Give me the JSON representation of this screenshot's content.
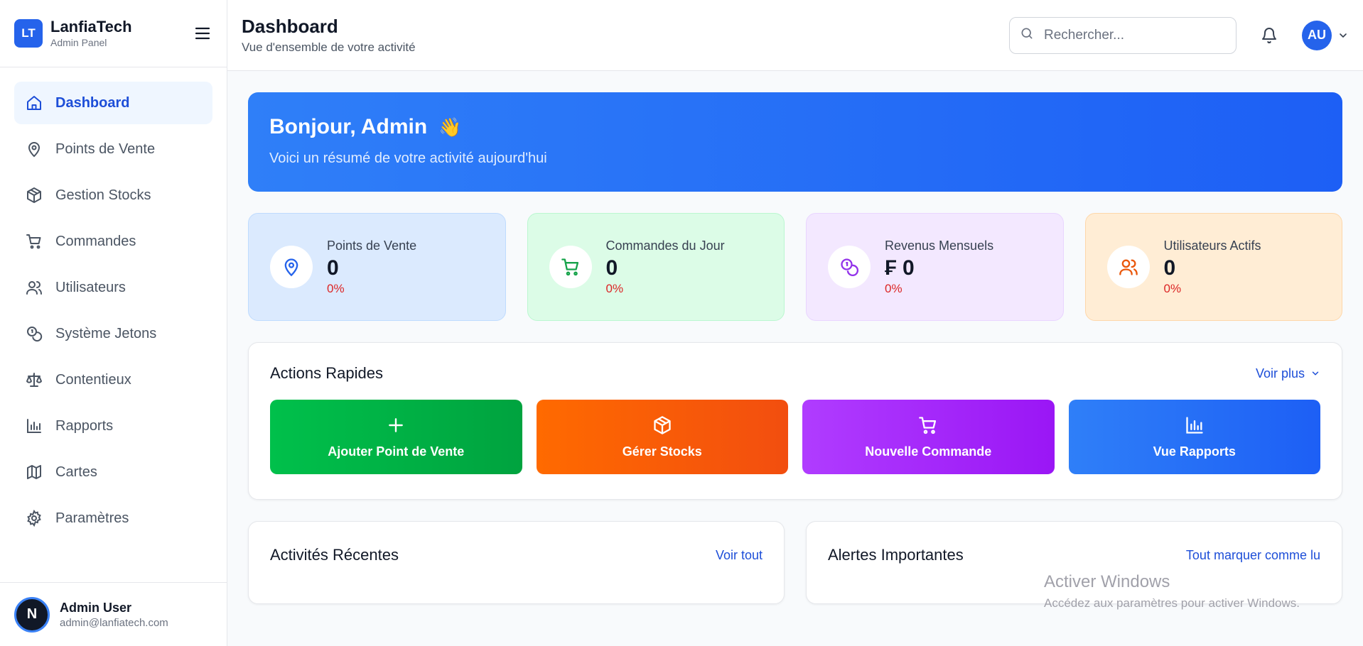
{
  "brand": {
    "logo": "LT",
    "name": "LanfiaTech",
    "subtitle": "Admin Panel"
  },
  "sidebar": {
    "items": [
      {
        "label": "Dashboard",
        "icon": "home-icon",
        "active": true
      },
      {
        "label": "Points de Vente",
        "icon": "map-pin-icon"
      },
      {
        "label": "Gestion Stocks",
        "icon": "package-icon"
      },
      {
        "label": "Commandes",
        "icon": "cart-icon"
      },
      {
        "label": "Utilisateurs",
        "icon": "users-icon"
      },
      {
        "label": "Système Jetons",
        "icon": "coins-icon"
      },
      {
        "label": "Contentieux",
        "icon": "scale-icon"
      },
      {
        "label": "Rapports",
        "icon": "bar-chart-icon"
      },
      {
        "label": "Cartes",
        "icon": "map-icon"
      },
      {
        "label": "Paramètres",
        "icon": "gear-icon"
      }
    ]
  },
  "user": {
    "initial": "N",
    "name": "Admin User",
    "email": "admin@lanfiatech.com"
  },
  "header": {
    "title": "Dashboard",
    "subtitle": "Vue d'ensemble de votre activité",
    "search_placeholder": "Rechercher...",
    "avatar_initials": "AU"
  },
  "welcome": {
    "title": "Bonjour, Admin",
    "emoji": "👋",
    "subtitle": "Voici un résumé de votre activité aujourd'hui"
  },
  "stats": [
    {
      "label": "Points de Vente",
      "value": "0",
      "change": "0%",
      "color": "#2563eb"
    },
    {
      "label": "Commandes du Jour",
      "value": "0",
      "change": "0%",
      "color": "#16a34a"
    },
    {
      "label": "Revenus Mensuels",
      "value": "₣ 0",
      "change": "0%",
      "color": "#9333ea"
    },
    {
      "label": "Utilisateurs Actifs",
      "value": "0",
      "change": "0%",
      "color": "#ea580c"
    }
  ],
  "quick_actions": {
    "title": "Actions Rapides",
    "more": "Voir plus",
    "items": [
      {
        "label": "Ajouter Point de Vente",
        "icon": "plus-icon"
      },
      {
        "label": "Gérer Stocks",
        "icon": "package-icon"
      },
      {
        "label": "Nouvelle Commande",
        "icon": "cart-icon"
      },
      {
        "label": "Vue Rapports",
        "icon": "bar-chart-icon"
      }
    ]
  },
  "recent": {
    "title": "Activités Récentes",
    "link": "Voir tout"
  },
  "alerts": {
    "title": "Alertes Importantes",
    "link": "Tout marquer comme lu"
  },
  "watermark": {
    "line1": "Activer Windows",
    "line2": "Accédez aux paramètres pour activer Windows."
  }
}
